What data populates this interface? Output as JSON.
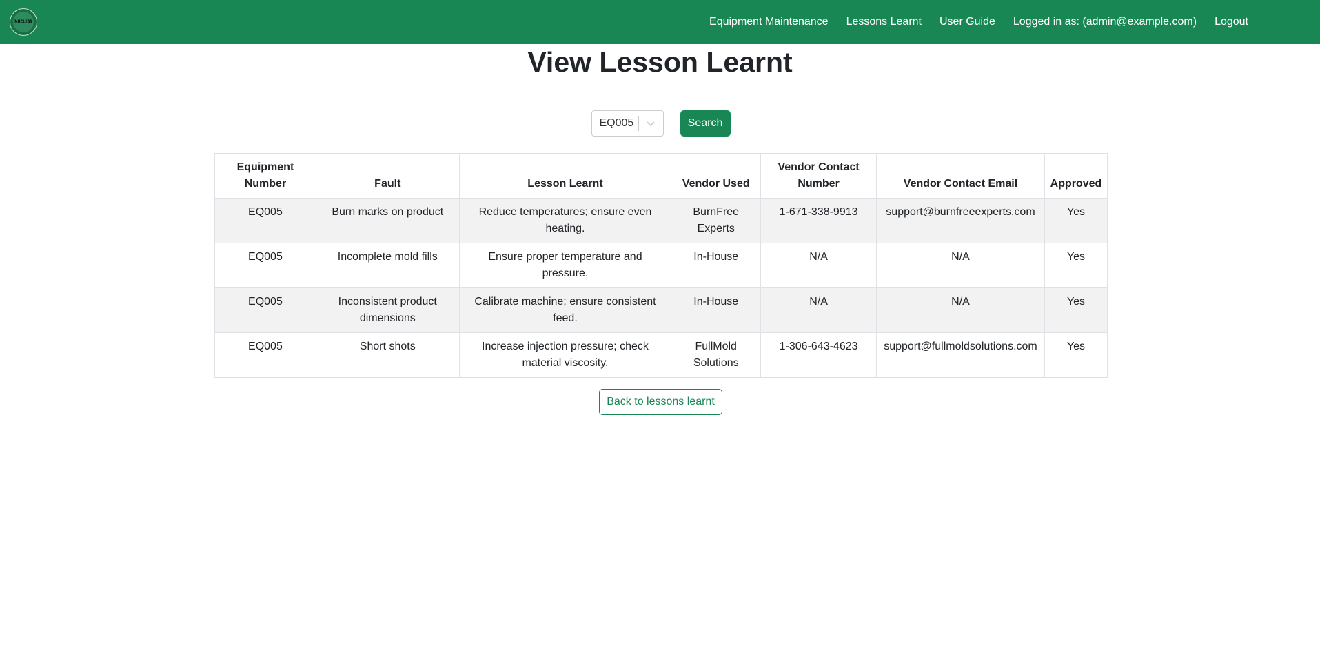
{
  "nav": {
    "logo_text": "NHCLESS",
    "links": [
      "Equipment Maintenance",
      "Lessons Learnt",
      "User Guide",
      "Logged in as: (admin@example.com)",
      "Logout"
    ]
  },
  "page": {
    "title": "View Lesson Learnt"
  },
  "search": {
    "selected": "EQ005",
    "button": "Search"
  },
  "table": {
    "headers": [
      "Equipment Number",
      "Fault",
      "Lesson Learnt",
      "Vendor Used",
      "Vendor Contact Number",
      "Vendor Contact Email",
      "Approved"
    ],
    "rows": [
      [
        "EQ005",
        "Burn marks on product",
        "Reduce temperatures; ensure even heating.",
        "BurnFree Experts",
        "1-671-338-9913",
        "support@burnfreeexperts.com",
        "Yes"
      ],
      [
        "EQ005",
        "Incomplete mold fills",
        "Ensure proper temperature and pressure.",
        "In-House",
        "N/A",
        "N/A",
        "Yes"
      ],
      [
        "EQ005",
        "Inconsistent product dimensions",
        "Calibrate machine; ensure consistent feed.",
        "In-House",
        "N/A",
        "N/A",
        "Yes"
      ],
      [
        "EQ005",
        "Short shots",
        "Increase injection pressure; check material viscosity.",
        "FullMold Solutions",
        "1-306-643-4623",
        "support@fullmoldsolutions.com",
        "Yes"
      ]
    ]
  },
  "back_button": "Back to lessons learnt",
  "colors": {
    "brand": "#198754",
    "stripe": "#f2f2f2",
    "border": "#dee2e6"
  },
  "icons": {
    "select_toggle": "chevron-down-icon"
  }
}
